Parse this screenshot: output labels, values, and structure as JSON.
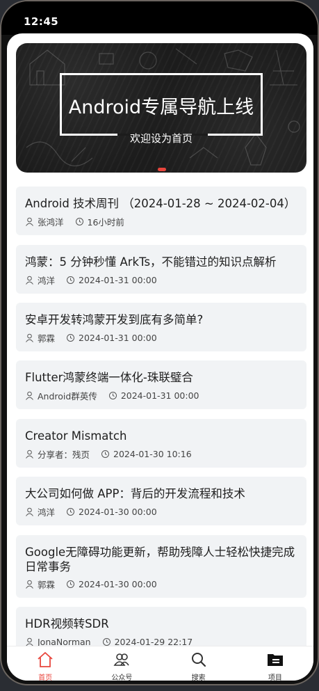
{
  "status_bar": {
    "time": "12:45"
  },
  "banner": {
    "title": "Android专属导航上线",
    "subtitle": "欢迎设为首页"
  },
  "articles": [
    {
      "title": "Android 技术周刊 （2024-01-28 ~ 2024-02-04）",
      "author": "张鸿洋",
      "time": "16小时前"
    },
    {
      "title": "鸿蒙：5 分钟秒懂 ArkTs，不能错过的知识点解析",
      "author": "鸿洋",
      "time": "2024-01-31 00:00"
    },
    {
      "title": "安卓开发转鸿蒙开发到底有多简单?",
      "author": "郭霖",
      "time": "2024-01-31 00:00"
    },
    {
      "title": "Flutter鸿蒙终端一体化-珠联璧合",
      "author": "Android群英传",
      "time": "2024-01-31 00:00"
    },
    {
      "title": "Creator Mismatch",
      "author": "分享者：残页",
      "time": "2024-01-30 10:16"
    },
    {
      "title": "大公司如何做 APP：背后的开发流程和技术",
      "author": "鸿洋",
      "time": "2024-01-30 00:00"
    },
    {
      "title": "Google无障碍功能更新，帮助残障人士轻松快捷完成日常事务",
      "author": "郭霖",
      "time": "2024-01-30 00:00"
    },
    {
      "title": "HDR视频转SDR",
      "author": "JonaNorman",
      "time": "2024-01-29 22:17"
    }
  ],
  "tabs": [
    {
      "label": "首页",
      "icon": "home-icon",
      "active": true
    },
    {
      "label": "公众号",
      "icon": "people-icon",
      "active": false
    },
    {
      "label": "搜索",
      "icon": "search-icon",
      "active": false
    },
    {
      "label": "项目",
      "icon": "folder-icon",
      "active": false
    }
  ],
  "colors": {
    "accent": "#e8453c",
    "card_bg": "#f1f3f5",
    "banner_bg": "#1c1c1c"
  }
}
